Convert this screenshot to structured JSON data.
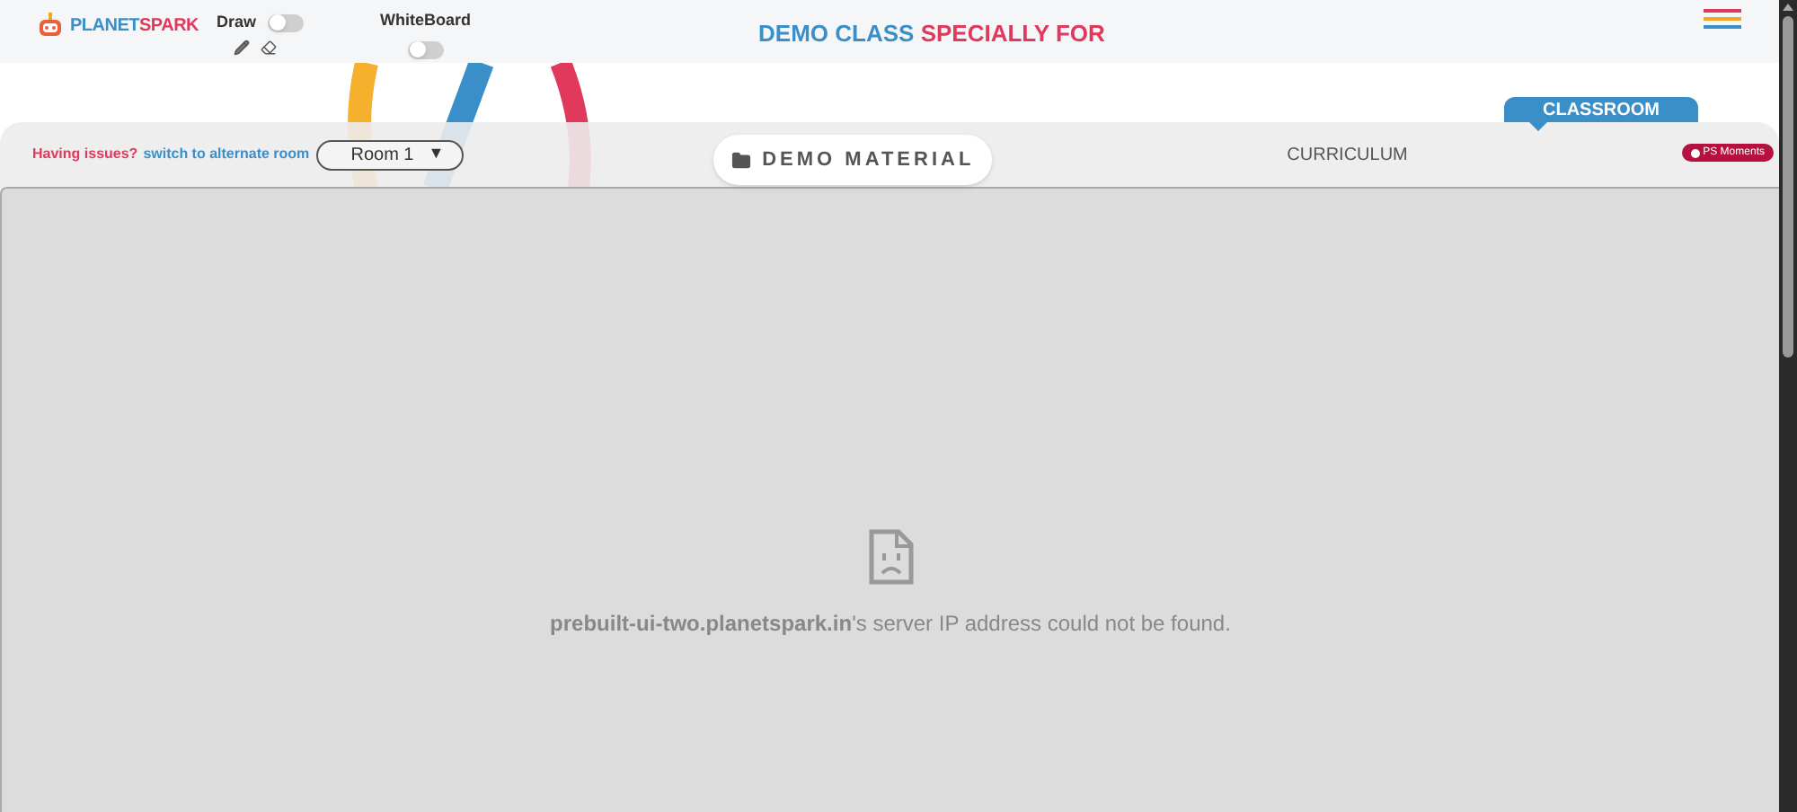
{
  "header": {
    "logo": [
      "PLANET",
      "SPARK"
    ],
    "toggles": [
      {
        "label": "Draw",
        "on": false
      },
      {
        "label": "WhiteBoard",
        "on": false
      }
    ],
    "title": [
      "DEMO CLASS",
      "SPECIALLY FOR"
    ]
  },
  "room_bar": {
    "issue": "Having issues?",
    "link": "switch to alternate room",
    "room": "Room 1",
    "caret": "▼"
  },
  "demo_material": "DEMO MATERIAL",
  "tabs": [
    {
      "label": "CURRICULUM",
      "selected": false
    },
    {
      "label": "CLASSROOM",
      "selected": true
    }
  ],
  "moments_badge": "PS Moments",
  "error": {
    "message": "**prebuilt-ui-two.planetspark.in**'s server IP address could not be found."
  }
}
